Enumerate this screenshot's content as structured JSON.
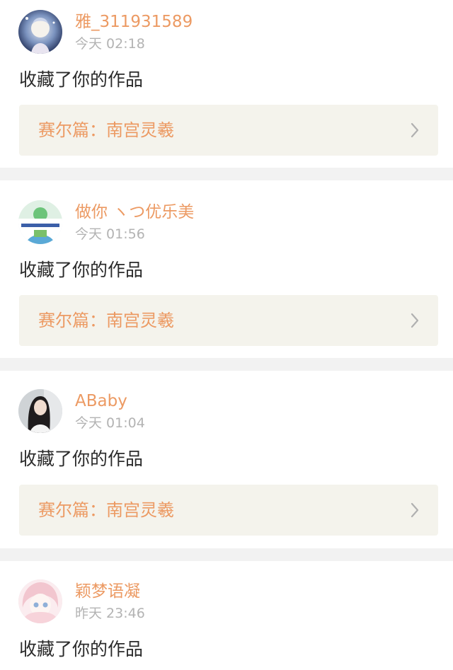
{
  "notifications": [
    {
      "username": "雅_311931589",
      "time": "今天 02:18",
      "action": "收藏了你的作品",
      "work_title": "赛尔篇：南宫灵羲",
      "avatar_icon": "anime-girl-moon-avatar"
    },
    {
      "username": "做你 ヽつ优乐美",
      "time": "今天 01:56",
      "action": "收藏了你的作品",
      "work_title": "赛尔篇：南宫灵羲",
      "avatar_icon": "landscape-badge-avatar"
    },
    {
      "username": "ABaby",
      "time": "今天 01:04",
      "action": "收藏了你的作品",
      "work_title": "赛尔篇：南宫灵羲",
      "avatar_icon": "portrait-photo-avatar"
    },
    {
      "username": "颖梦语凝",
      "time": "昨天 23:46",
      "action": "收藏了你的作品",
      "avatar_icon": "anime-girl-pink-avatar"
    }
  ],
  "colors": {
    "accent": "#ec9a63",
    "muted": "#b3b3b3",
    "link_bg": "#f4f3ec",
    "separator": "#f2f2f2"
  }
}
